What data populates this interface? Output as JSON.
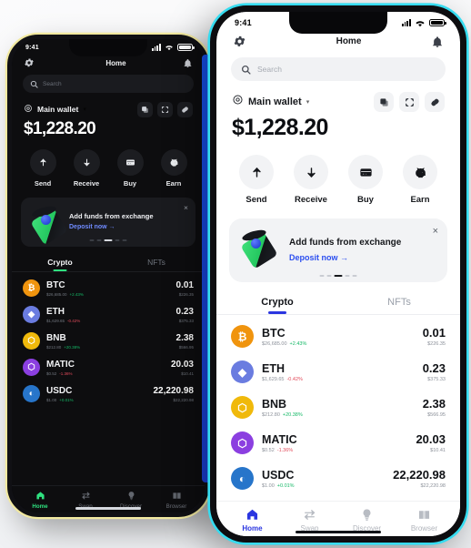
{
  "colors": {
    "accent_light": "#2b36e0",
    "accent_dark": "#2fe07f",
    "up": "#14b866",
    "down": "#e24b5b",
    "btc": "#f0940e",
    "eth": "#6a7ce0",
    "bnb": "#f0b90b",
    "matic": "#8b3fe0",
    "usdc": "#2775ca"
  },
  "status_bar": {
    "time": "9:41"
  },
  "header": {
    "title": "Home",
    "gear_icon": "gear-icon",
    "bell_icon": "bell-icon"
  },
  "search": {
    "placeholder": "Search",
    "icon": "search-icon"
  },
  "wallet": {
    "eye_icon": "eye-icon",
    "name": "Main wallet",
    "caret": "▾",
    "balance": "$1,228.20",
    "actions": [
      {
        "name": "copy-icon"
      },
      {
        "name": "scan-icon"
      },
      {
        "name": "link-icon"
      }
    ]
  },
  "quick_actions": [
    {
      "label": "Send",
      "icon": "arrow-up-icon"
    },
    {
      "label": "Receive",
      "icon": "arrow-down-icon"
    },
    {
      "label": "Buy",
      "icon": "credit-card-icon"
    },
    {
      "label": "Earn",
      "icon": "piggy-bank-icon"
    }
  ],
  "promo": {
    "title": "Add funds from exchange",
    "cta": "Deposit now  →",
    "close": "×",
    "dots": 5,
    "active_dot": 2
  },
  "tabs": [
    {
      "label": "Crypto",
      "active": true
    },
    {
      "label": "NFTs",
      "active": false
    }
  ],
  "coins": [
    {
      "symbol": "BTC",
      "glyph": "₿",
      "color": "#f0940e",
      "price": "$26,685.00",
      "change": "+2.43%",
      "dir": "up",
      "amount": "0.01",
      "value": "$226.35"
    },
    {
      "symbol": "ETH",
      "glyph": "◆",
      "color": "#6a7ce0",
      "price": "$1,629.65",
      "change": "-0.42%",
      "dir": "down",
      "amount": "0.23",
      "value": "$375.33"
    },
    {
      "symbol": "BNB",
      "glyph": "⬡",
      "color": "#f0b90b",
      "price": "$212.80",
      "change": "+20.38%",
      "dir": "up",
      "amount": "2.38",
      "value": "$566.95"
    },
    {
      "symbol": "MATIC",
      "glyph": "⬡",
      "color": "#8b3fe0",
      "price": "$0.52",
      "change": "-1.36%",
      "dir": "down",
      "amount": "20.03",
      "value": "$10.41"
    },
    {
      "symbol": "USDC",
      "glyph": "◐",
      "color": "#2775ca",
      "price": "$1.00",
      "change": "+0.01%",
      "dir": "up",
      "amount": "22,220.98",
      "value": "$22,220.98"
    }
  ],
  "bottom_nav": [
    {
      "label": "Home",
      "icon": "home-icon",
      "active": true
    },
    {
      "label": "Swap",
      "icon": "swap-icon",
      "active": false
    },
    {
      "label": "Discover",
      "icon": "bulb-icon",
      "active": false
    },
    {
      "label": "Browser",
      "icon": "book-icon",
      "active": false
    }
  ]
}
